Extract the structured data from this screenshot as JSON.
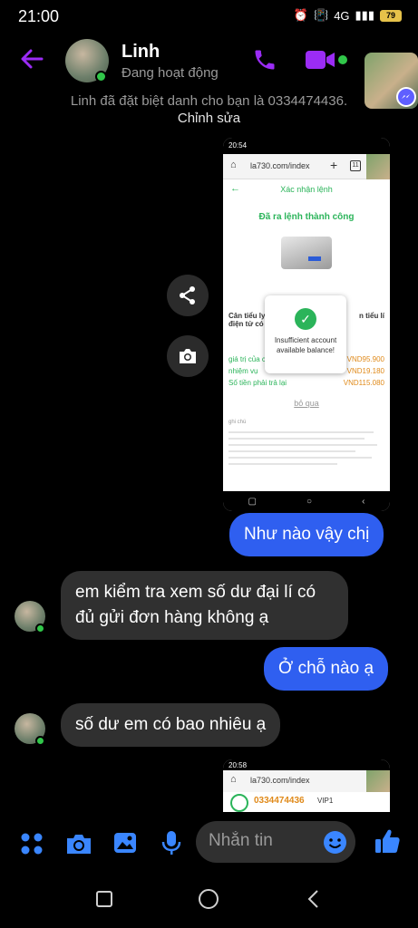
{
  "status_bar": {
    "time": "21:00",
    "network": "4G",
    "battery": "79"
  },
  "header": {
    "contact_name": "Linh",
    "activity_status": "Đang hoạt động",
    "colors": {
      "accent": "#9b2cf5",
      "online": "#31c74a"
    },
    "icons": [
      "back-arrow-icon",
      "phone-icon",
      "video-icon",
      "messenger-icon"
    ]
  },
  "system_message": {
    "text": "Linh đã đặt biệt danh cho bạn là 0334474436.",
    "action": "Chỉnh sửa"
  },
  "screenshot_1": {
    "status_time": "20:54",
    "url": "la730.com/index",
    "tab_count": "11",
    "page_title": "Xác nhận lệnh",
    "success_text": "Đã ra lệnh thành công",
    "product_title_left": "Cân tiểu ly",
    "product_title_right": "n tiểu lí",
    "product_title_line2": "điện tử có",
    "dialog_message": "Insufficient account available balance!",
    "rows": [
      {
        "label": "giá trị của c",
        "value": "VND95.900"
      },
      {
        "label": "nhiệm vụ",
        "value": "VND19.180"
      },
      {
        "label": "Số tiền phải trả lại",
        "value": "VND115.080"
      }
    ],
    "skip_link": "bỏ qua",
    "notes_title": "ghi chú"
  },
  "floating_buttons": [
    "share-icon",
    "camera-icon"
  ],
  "messages": [
    {
      "direction": "out",
      "text": "Như nào vậy chị"
    },
    {
      "direction": "in",
      "text": "em kiểm tra xem số dư đại lí có đủ gửi đơn hàng không ạ"
    },
    {
      "direction": "out",
      "text": "Ở chỗ nào ạ"
    },
    {
      "direction": "in",
      "text": "số dư em có bao nhiêu ạ"
    }
  ],
  "screenshot_2": {
    "status_time": "20:58",
    "url": "la730.com/index",
    "account": "0334474436",
    "vip": "VIP1"
  },
  "composer": {
    "placeholder": "Nhắn tin",
    "colors": {
      "icon": "#3a86ff"
    }
  }
}
